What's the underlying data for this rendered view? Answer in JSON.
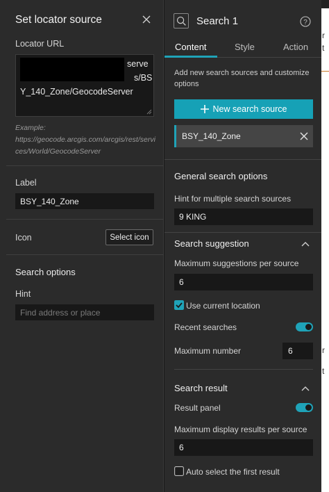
{
  "left": {
    "title": "Set locator source",
    "locator_url_label": "Locator URL",
    "url_visible_fragments": [
      "serve",
      "s/BS",
      "Y_140_Zone/GeocodeServer"
    ],
    "example_label": "Example:",
    "example_url": "https://geocode.arcgis.com/arcgis/rest/services/World/GeocodeServer",
    "label_label": "Label",
    "label_value": "BSY_140_Zone",
    "icon_label": "Icon",
    "select_icon_button": "Select icon",
    "search_options_heading": "Search options",
    "hint_label": "Hint",
    "hint_placeholder": "Find address or place"
  },
  "right": {
    "title": "Search 1",
    "tabs": [
      "Content",
      "Style",
      "Action"
    ],
    "active_tab": "Content",
    "intro": "Add new search sources and customize options",
    "new_source_button": "New search source",
    "source_item": "BSY_140_Zone",
    "general_heading": "General search options",
    "hint_multi_label": "Hint for multiple search sources",
    "hint_multi_value": "9 KING",
    "suggestion_heading": "Search suggestion",
    "max_suggestions_label": "Maximum suggestions per source",
    "max_suggestions_value": "6",
    "use_current_location_label": "Use current location",
    "use_current_location_checked": true,
    "recent_searches_label": "Recent searches",
    "recent_searches_on": true,
    "max_number_label": "Maximum number",
    "max_number_value": "6",
    "result_heading": "Search result",
    "result_panel_label": "Result panel",
    "result_panel_on": true,
    "max_display_label": "Maximum display results per source",
    "max_display_value": "6",
    "auto_select_label": "Auto select the first result",
    "auto_select_checked": false
  },
  "colors": {
    "accent": "#1fa3b8",
    "panel_bg": "#2b2b2b",
    "input_bg": "#181818"
  }
}
